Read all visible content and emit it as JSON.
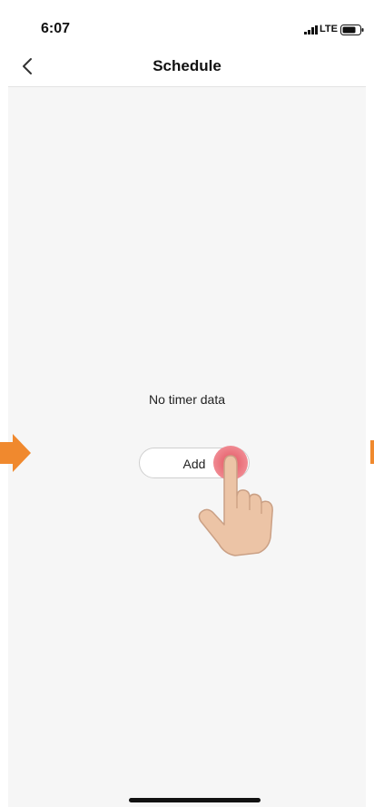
{
  "status": {
    "time": "6:07",
    "network": "LTE"
  },
  "navbar": {
    "title": "Schedule"
  },
  "main": {
    "empty_text": "No timer data",
    "add_label": "Add"
  },
  "colors": {
    "accent_arrow": "#f0892e",
    "tap_indicator": "#e25460",
    "background": "#f6f6f6"
  }
}
